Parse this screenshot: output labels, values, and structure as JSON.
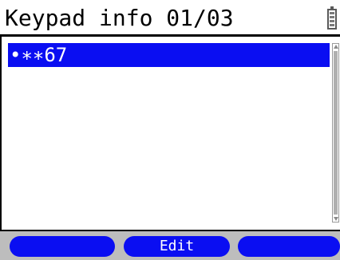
{
  "header": {
    "title": "Keypad info 01/03",
    "battery_icon": "battery-icon"
  },
  "list": {
    "items": [
      {
        "label": "•∗∗67",
        "selected": true
      }
    ]
  },
  "softkeys": {
    "left": "",
    "center": "Edit",
    "right": ""
  },
  "colors": {
    "selection": "#0a0ef2",
    "softkey": "#0a0ef2",
    "softkey_bar": "#bdbdbd",
    "text_on_selection": "#ffffff"
  }
}
